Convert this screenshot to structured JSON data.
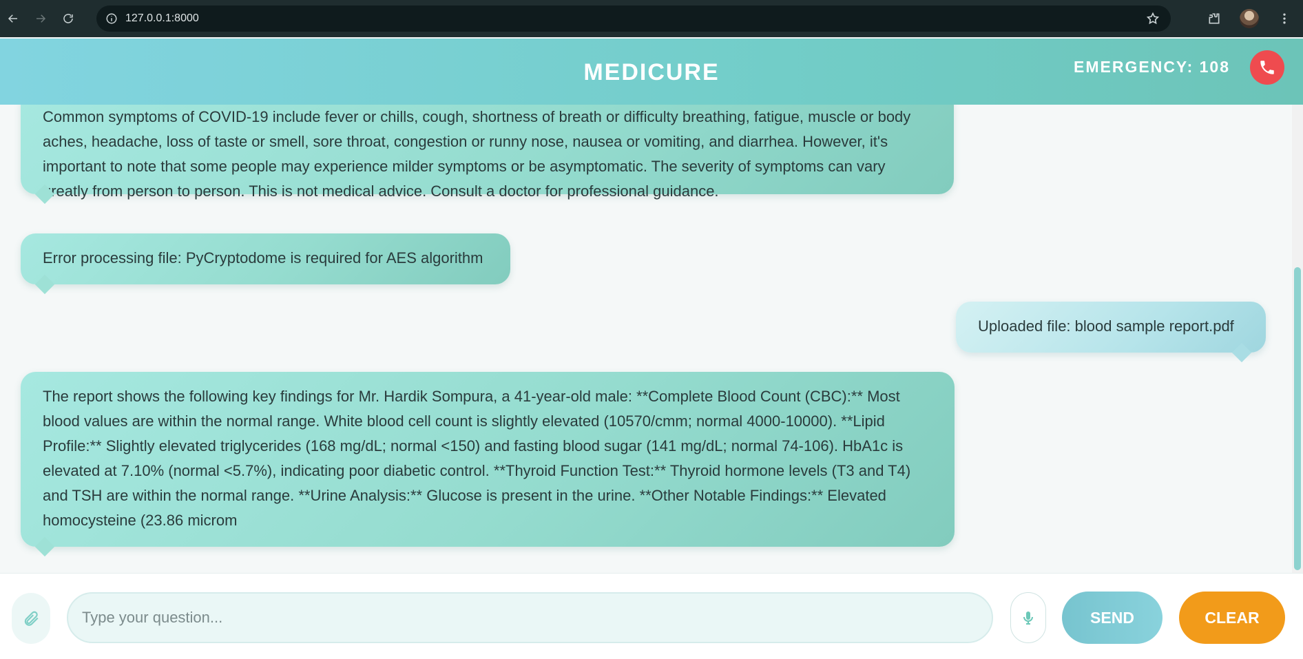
{
  "browser": {
    "url": "127.0.0.1:8000"
  },
  "header": {
    "title": "MEDICURE",
    "emergency_label": "EMERGENCY: 108"
  },
  "messages": [
    {
      "role": "bot",
      "text": "Common symptoms of COVID-19 include fever or chills, cough, shortness of breath or difficulty breathing, fatigue, muscle or body aches, headache, loss of taste or smell, sore throat, congestion or runny nose, nausea or vomiting, and diarrhea. However, it's important to note that some people may experience milder symptoms or be asymptomatic. The severity of symptoms can vary greatly from person to person. This is not medical advice. Consult a doctor for professional guidance."
    },
    {
      "role": "bot",
      "text": "Error processing file: PyCryptodome is required for AES algorithm"
    },
    {
      "role": "user",
      "text": "Uploaded file: blood sample report.pdf"
    },
    {
      "role": "bot",
      "text": "The report shows the following key findings for Mr. Hardik Sompura, a 41-year-old male: **Complete Blood Count (CBC):** Most blood values are within the normal range. White blood cell count is slightly elevated (10570/cmm; normal 4000-10000). **Lipid Profile:** Slightly elevated triglycerides (168 mg/dL; normal <150) and fasting blood sugar (141 mg/dL; normal 74-106). HbA1c is elevated at 7.10% (normal <5.7%), indicating poor diabetic control. **Thyroid Function Test:** Thyroid hormone levels (T3 and T4) and TSH are within the normal range. **Urine Analysis:** Glucose is present in the urine. **Other Notable Findings:** Elevated homocysteine (23.86 microm"
    }
  ],
  "composer": {
    "placeholder": "Type your question...",
    "value": "",
    "send_label": "SEND",
    "clear_label": "CLEAR"
  },
  "colors": {
    "header_accent": "#72cdc8",
    "emergency": "#ef4b4f",
    "clear": "#f29b1a",
    "send": "#7fcbd5"
  }
}
